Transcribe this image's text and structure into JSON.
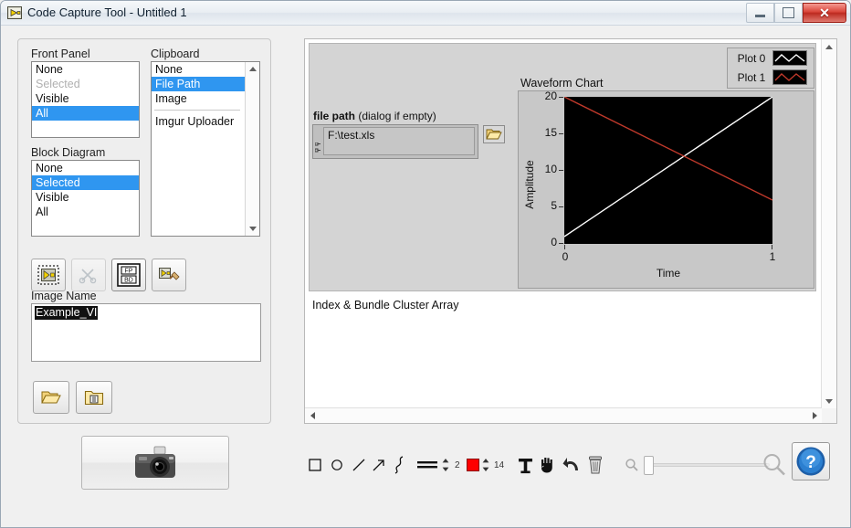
{
  "window": {
    "title": "Code Capture Tool - Untitled 1",
    "icon": "labview-vi-icon",
    "controls": {
      "minimize": "minimize-button",
      "maximize": "maximize-button",
      "close_label": "✕"
    }
  },
  "left_panel": {
    "front_panel": {
      "label": "Front Panel",
      "items": [
        {
          "label": "None",
          "state": "normal"
        },
        {
          "label": "Selected",
          "state": "disabled"
        },
        {
          "label": "Visible",
          "state": "normal"
        },
        {
          "label": "All",
          "state": "selected"
        }
      ]
    },
    "block_diagram": {
      "label": "Block Diagram",
      "items": [
        {
          "label": "None",
          "state": "normal"
        },
        {
          "label": "Selected",
          "state": "selected"
        },
        {
          "label": "Visible",
          "state": "normal"
        },
        {
          "label": "All",
          "state": "normal"
        }
      ]
    },
    "clipboard": {
      "label": "Clipboard",
      "items": [
        {
          "label": "None",
          "state": "normal"
        },
        {
          "label": "File Path",
          "state": "selected"
        },
        {
          "label": "Image",
          "state": "normal"
        }
      ],
      "extra_items": [
        {
          "label": "Imgur Uploader",
          "state": "normal"
        }
      ]
    },
    "action_buttons": [
      {
        "name": "select-vi-button",
        "icon": "select-vi-icon",
        "enabled": true
      },
      {
        "name": "tools-button",
        "icon": "scissors-tools-icon",
        "enabled": false
      },
      {
        "name": "fp-bd-button",
        "icon": "fp-bd-icon",
        "enabled": true,
        "top_label": "FP",
        "bottom_label": "BD"
      },
      {
        "name": "cleanup-button",
        "icon": "vi-broom-icon",
        "enabled": true
      }
    ],
    "image_name": {
      "label": "Image Name",
      "value": "Example_VI"
    },
    "file_buttons": [
      {
        "name": "open-folder-button",
        "icon": "open-folder-icon"
      },
      {
        "name": "save-to-folder-button",
        "icon": "folder-save-icon"
      }
    ],
    "capture_button": {
      "name": "capture-button",
      "icon": "camera-icon"
    }
  },
  "preview": {
    "front_panel_controls": {
      "file_path_label_bold": "file path",
      "file_path_label_rest": " (dialog if empty)",
      "file_path_value": "F:\\test.xls",
      "browse_icon": "folder-browse-icon"
    },
    "sub_label": "Index & Bundle Cluster Array"
  },
  "chart_data": {
    "type": "line",
    "title": "Waveform Chart",
    "xlabel": "Time",
    "ylabel": "Amplitude",
    "xlim": [
      0,
      1
    ],
    "ylim": [
      0,
      20
    ],
    "xticks": [
      "0",
      "1"
    ],
    "yticks": [
      "0",
      "5",
      "10",
      "15",
      "20"
    ],
    "grid": false,
    "legend_position": "top-right",
    "plot_background": "#000000",
    "series": [
      {
        "name": "Plot 0",
        "color": "#ffffff",
        "x": [
          0,
          1
        ],
        "values": [
          1,
          20
        ]
      },
      {
        "name": "Plot 1",
        "color": "#c0392b",
        "x": [
          0,
          1
        ],
        "values": [
          20,
          6
        ]
      }
    ]
  },
  "bottom_toolbar": {
    "tools": [
      {
        "name": "rectangle-tool",
        "icon": "square-icon"
      },
      {
        "name": "ellipse-tool",
        "icon": "circle-icon"
      },
      {
        "name": "line-tool",
        "icon": "line-icon"
      },
      {
        "name": "arrow-tool",
        "icon": "arrow-icon"
      },
      {
        "name": "curve-tool",
        "icon": "curve-icon"
      }
    ],
    "line_width": {
      "name": "line-width-stepper",
      "icon": "line-style-icon",
      "value": "2"
    },
    "color": {
      "name": "color-stepper",
      "swatch_hex": "#ff0000",
      "value": "14"
    },
    "right_tools": [
      {
        "name": "text-tool",
        "icon": "text-T-icon"
      },
      {
        "name": "hand-tool",
        "icon": "hand-icon"
      },
      {
        "name": "undo-tool",
        "icon": "undo-arrow-icon"
      },
      {
        "name": "delete-tool",
        "icon": "trash-icon"
      }
    ],
    "zoom": {
      "zoom_out_icon": "magnifier-small-icon",
      "zoom_in_icon": "magnifier-large-icon",
      "slider_name": "zoom-slider",
      "slider_position_pct": 0
    },
    "help": {
      "name": "help-button",
      "icon": "question-mark-icon",
      "label": "?"
    }
  }
}
